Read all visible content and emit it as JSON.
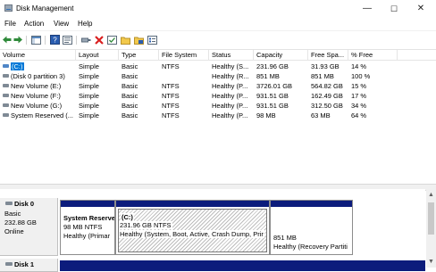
{
  "window": {
    "title": "Disk Management",
    "minimize_glyph": "—",
    "maximize_glyph": "☐",
    "close_glyph": "✕"
  },
  "menu": [
    "File",
    "Action",
    "View",
    "Help"
  ],
  "toolbar": {
    "icons": [
      "back-arrow-icon",
      "forward-arrow-icon",
      "console-tree-icon",
      "help-icon",
      "properties-icon",
      "connect-icon",
      "delete-icon",
      "check-icon",
      "folder-icon",
      "disk-wizard-icon",
      "list-view-icon"
    ]
  },
  "volume_table": {
    "columns": [
      "Volume",
      "Layout",
      "Type",
      "File System",
      "Status",
      "Capacity",
      "Free Spa...",
      "% Free"
    ],
    "rows": [
      {
        "volume": "(C:)",
        "layout": "Simple",
        "type": "Basic",
        "fs": "NTFS",
        "status": "Healthy (S...",
        "capacity": "231.96 GB",
        "free": "31.93 GB",
        "pct": "14 %",
        "selected": true
      },
      {
        "volume": "(Disk 0 partition 3)",
        "layout": "Simple",
        "type": "Basic",
        "fs": "",
        "status": "Healthy (R...",
        "capacity": "851 MB",
        "free": "851 MB",
        "pct": "100 %",
        "selected": false
      },
      {
        "volume": "New Volume (E:)",
        "layout": "Simple",
        "type": "Basic",
        "fs": "NTFS",
        "status": "Healthy (P...",
        "capacity": "3726.01 GB",
        "free": "564.82 GB",
        "pct": "15 %",
        "selected": false
      },
      {
        "volume": "New Volume (F:)",
        "layout": "Simple",
        "type": "Basic",
        "fs": "NTFS",
        "status": "Healthy (P...",
        "capacity": "931.51 GB",
        "free": "162.49 GB",
        "pct": "17 %",
        "selected": false
      },
      {
        "volume": "New Volume (G:)",
        "layout": "Simple",
        "type": "Basic",
        "fs": "NTFS",
        "status": "Healthy (P...",
        "capacity": "931.51 GB",
        "free": "312.50 GB",
        "pct": "34 %",
        "selected": false
      },
      {
        "volume": "System Reserved (...",
        "layout": "Simple",
        "type": "Basic",
        "fs": "NTFS",
        "status": "Healthy (P...",
        "capacity": "98 MB",
        "free": "63 MB",
        "pct": "64 %",
        "selected": false
      }
    ]
  },
  "disks": [
    {
      "name": "Disk 0",
      "type": "Basic",
      "size": "232.88 GB",
      "state": "Online",
      "partitions": [
        {
          "name": "System Reserve",
          "line1": "98 MB NTFS",
          "line2": "Healthy (Primar"
        },
        {
          "name": "(C:)",
          "line1": "231.96 GB NTFS",
          "line2": "Healthy (System, Boot, Active, Crash Dump, Prir"
        },
        {
          "name": "",
          "line1": "851 MB",
          "line2": "Healthy (Recovery Partiti"
        }
      ]
    },
    {
      "name": "Disk 1"
    }
  ],
  "colors": {
    "partition_bar": "#0c1c7c",
    "selection": "#0078d7",
    "delete_icon": "#d92020"
  }
}
